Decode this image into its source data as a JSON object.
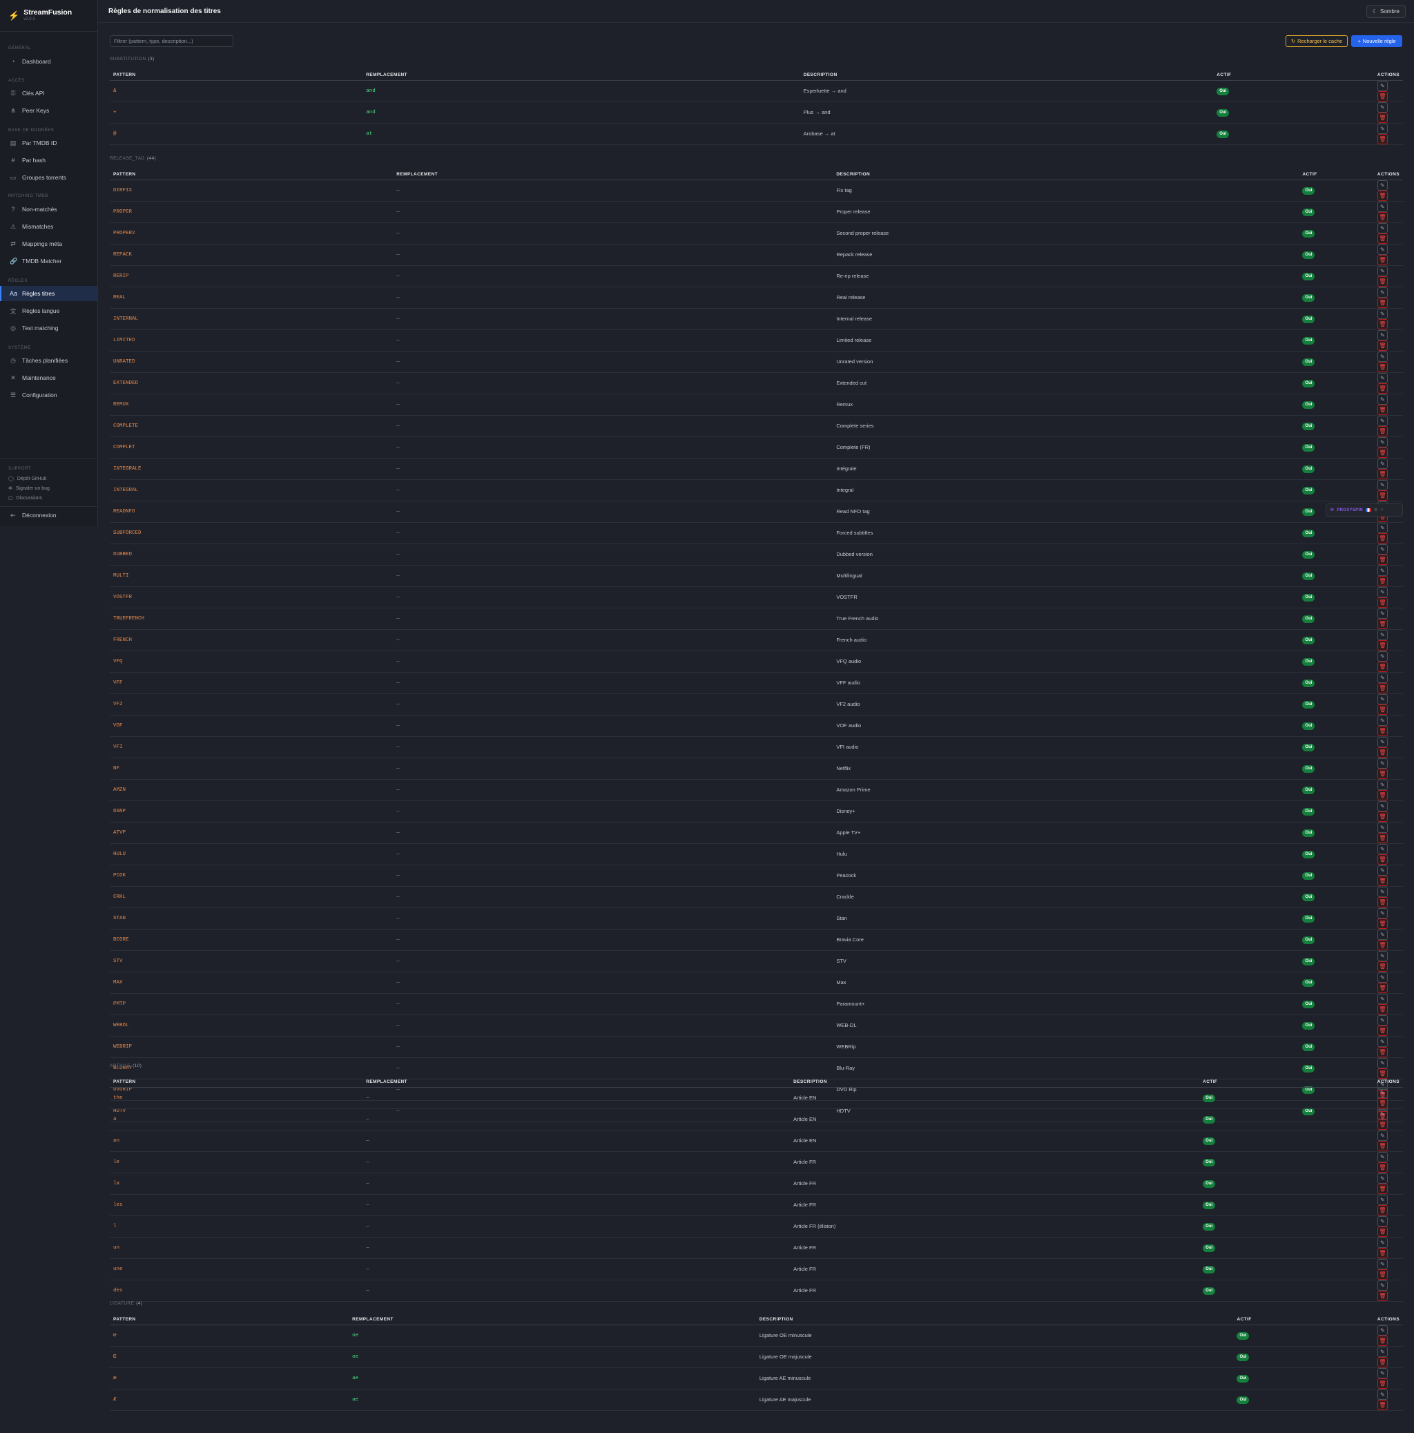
{
  "app": {
    "name": "StreamFusion",
    "version": "v2.0.1"
  },
  "header": {
    "title": "Règles de normalisation des titres",
    "theme_label": "Sombre"
  },
  "sidebar": {
    "sections": [
      {
        "label": "GÉNÉRAL",
        "items": [
          {
            "label": "Dashboard",
            "icon": "gauge-icon"
          }
        ]
      },
      {
        "label": "ACCÈS",
        "items": [
          {
            "label": "Clés API",
            "icon": "key-icon"
          },
          {
            "label": "Peer Keys",
            "icon": "network-icon"
          }
        ]
      },
      {
        "label": "BASE DE DONNÉES",
        "items": [
          {
            "label": "Par TMDB ID",
            "icon": "database-icon"
          },
          {
            "label": "Par hash",
            "icon": "hash-icon"
          },
          {
            "label": "Groupes torrents",
            "icon": "box-icon"
          }
        ]
      },
      {
        "label": "MATCHING TMDB",
        "items": [
          {
            "label": "Non-matchés",
            "icon": "question-icon"
          },
          {
            "label": "Mismatches",
            "icon": "warning-icon"
          },
          {
            "label": "Mappings méta",
            "icon": "arrows-icon"
          },
          {
            "label": "TMDB Matcher",
            "icon": "link-icon"
          }
        ]
      },
      {
        "label": "RÈGLES",
        "items": [
          {
            "label": "Règles titres",
            "icon": "text-aa-icon",
            "active": true
          },
          {
            "label": "Règles langue",
            "icon": "language-icon"
          },
          {
            "label": "Test matching",
            "icon": "target-icon"
          }
        ]
      },
      {
        "label": "SYSTÈME",
        "items": [
          {
            "label": "Tâches planifiées",
            "icon": "clock-icon"
          },
          {
            "label": "Maintenance",
            "icon": "wrench-icon"
          },
          {
            "label": "Configuration",
            "icon": "sliders-icon"
          }
        ]
      }
    ],
    "support": {
      "label": "SUPPORT",
      "items": [
        {
          "label": "Dépôt GitHub",
          "icon": "github-icon"
        },
        {
          "label": "Signaler un bug",
          "icon": "bug-icon"
        },
        {
          "label": "Discussions",
          "icon": "chat-icon"
        }
      ]
    },
    "logout_label": "Déconnexion"
  },
  "toolbar": {
    "filter_placeholder": "Filtrer (pattern, type, description...)",
    "reload_label": "Recharger le cache",
    "new_label": "Nouvelle règle"
  },
  "columns": {
    "pattern": "PATTERN",
    "replacement": "REMPLACEMENT",
    "description": "DESCRIPTION",
    "active": "ACTIF",
    "actions": "ACTIONS"
  },
  "active_badge": "Oui",
  "groups": [
    {
      "name": "SUBSTITUTION",
      "count": "(3)",
      "rows": [
        {
          "pattern": "&",
          "replacement": "and",
          "description": "Esperluette → and"
        },
        {
          "pattern": "+",
          "replacement": "and",
          "description": "Plus → and"
        },
        {
          "pattern": "@",
          "replacement": "at",
          "description": "Arobase → at"
        }
      ]
    },
    {
      "name": "RELEASE_TAG",
      "count": "(44)",
      "rows": [
        {
          "pattern": "DIRFIX",
          "replacement": "—",
          "description": "Fix tag"
        },
        {
          "pattern": "PROPER",
          "replacement": "—",
          "description": "Proper release"
        },
        {
          "pattern": "PROPER2",
          "replacement": "—",
          "description": "Second proper release"
        },
        {
          "pattern": "REPACK",
          "replacement": "—",
          "description": "Repack release"
        },
        {
          "pattern": "RERIP",
          "replacement": "—",
          "description": "Re-rip release"
        },
        {
          "pattern": "REAL",
          "replacement": "—",
          "description": "Real release"
        },
        {
          "pattern": "INTERNAL",
          "replacement": "—",
          "description": "Internal release"
        },
        {
          "pattern": "LIMITED",
          "replacement": "—",
          "description": "Limited release"
        },
        {
          "pattern": "UNRATED",
          "replacement": "—",
          "description": "Unrated version"
        },
        {
          "pattern": "EXTENDED",
          "replacement": "—",
          "description": "Extended cut"
        },
        {
          "pattern": "REMUX",
          "replacement": "—",
          "description": "Remux"
        },
        {
          "pattern": "COMPLETE",
          "replacement": "—",
          "description": "Complete series"
        },
        {
          "pattern": "COMPLET",
          "replacement": "—",
          "description": "Complete (FR)"
        },
        {
          "pattern": "INTEGRALE",
          "replacement": "—",
          "description": "Intégrale"
        },
        {
          "pattern": "INTEGRAL",
          "replacement": "—",
          "description": "Integral"
        },
        {
          "pattern": "READNFO",
          "replacement": "—",
          "description": "Read NFO tag"
        },
        {
          "pattern": "SUBFORCED",
          "replacement": "—",
          "description": "Forced subtitles"
        },
        {
          "pattern": "DUBBED",
          "replacement": "—",
          "description": "Dubbed version"
        },
        {
          "pattern": "MULTI",
          "replacement": "—",
          "description": "Multilingual"
        },
        {
          "pattern": "VOSTFR",
          "replacement": "—",
          "description": "VOSTFR"
        },
        {
          "pattern": "TRUEFRENCH",
          "replacement": "—",
          "description": "True French audio"
        },
        {
          "pattern": "FRENCH",
          "replacement": "—",
          "description": "French audio"
        },
        {
          "pattern": "VFQ",
          "replacement": "—",
          "description": "VFQ audio"
        },
        {
          "pattern": "VFF",
          "replacement": "—",
          "description": "VFF audio"
        },
        {
          "pattern": "VF2",
          "replacement": "—",
          "description": "VF2 audio"
        },
        {
          "pattern": "VOF",
          "replacement": "—",
          "description": "VOF audio"
        },
        {
          "pattern": "VFI",
          "replacement": "—",
          "description": "VFI audio"
        },
        {
          "pattern": "NF",
          "replacement": "—",
          "description": "Netflix"
        },
        {
          "pattern": "AMZN",
          "replacement": "—",
          "description": "Amazon Prime"
        },
        {
          "pattern": "DSNP",
          "replacement": "—",
          "description": "Disney+"
        },
        {
          "pattern": "ATVP",
          "replacement": "—",
          "description": "Apple TV+"
        },
        {
          "pattern": "HULU",
          "replacement": "—",
          "description": "Hulu"
        },
        {
          "pattern": "PCOK",
          "replacement": "—",
          "description": "Peacock"
        },
        {
          "pattern": "CRKL",
          "replacement": "—",
          "description": "Crackle"
        },
        {
          "pattern": "STAN",
          "replacement": "—",
          "description": "Stan"
        },
        {
          "pattern": "BCORE",
          "replacement": "—",
          "description": "Bravia Core"
        },
        {
          "pattern": "STV",
          "replacement": "—",
          "description": "STV"
        },
        {
          "pattern": "MAX",
          "replacement": "—",
          "description": "Max"
        },
        {
          "pattern": "PMTP",
          "replacement": "—",
          "description": "Paramount+"
        },
        {
          "pattern": "WEBDL",
          "replacement": "—",
          "description": "WEB-DL"
        },
        {
          "pattern": "WEBRIP",
          "replacement": "—",
          "description": "WEBRip"
        },
        {
          "pattern": "BLURAY",
          "replacement": "—",
          "description": "Blu-Ray"
        },
        {
          "pattern": "DVDRIP",
          "replacement": "—",
          "description": "DVD Rip"
        },
        {
          "pattern": "HDTV",
          "replacement": "—",
          "description": "HDTV"
        }
      ]
    },
    {
      "name": "ARTICLE",
      "count": "(10)",
      "rows": [
        {
          "pattern": "the",
          "replacement": "—",
          "description": "Article EN"
        },
        {
          "pattern": "a",
          "replacement": "—",
          "description": "Article EN"
        },
        {
          "pattern": "an",
          "replacement": "—",
          "description": "Article EN"
        },
        {
          "pattern": "le",
          "replacement": "—",
          "description": "Article FR"
        },
        {
          "pattern": "la",
          "replacement": "—",
          "description": "Article FR"
        },
        {
          "pattern": "les",
          "replacement": "—",
          "description": "Article FR"
        },
        {
          "pattern": "l",
          "replacement": "—",
          "description": "Article FR (élision)"
        },
        {
          "pattern": "un",
          "replacement": "—",
          "description": "Article FR"
        },
        {
          "pattern": "une",
          "replacement": "—",
          "description": "Article FR"
        },
        {
          "pattern": "des",
          "replacement": "—",
          "description": "Article FR"
        }
      ]
    },
    {
      "name": "LIGATURE",
      "count": "(4)",
      "rows": [
        {
          "pattern": "œ",
          "replacement": "oe",
          "description": "Ligature OE minuscule"
        },
        {
          "pattern": "Œ",
          "replacement": "oe",
          "description": "Ligature OE majuscule"
        },
        {
          "pattern": "æ",
          "replacement": "ae",
          "description": "Ligature AE minuscule"
        },
        {
          "pattern": "Æ",
          "replacement": "ae",
          "description": "Ligature AE majuscule"
        }
      ]
    }
  ],
  "proxyspin": {
    "label": "PROXYSPIN"
  }
}
